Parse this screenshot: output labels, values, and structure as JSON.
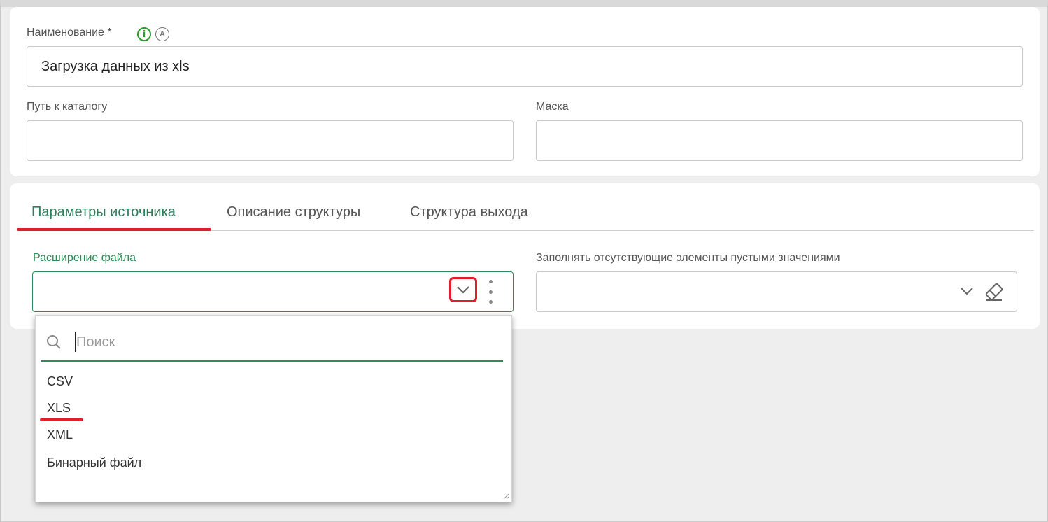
{
  "form": {
    "name_label": "Наименование *",
    "name_value": "Загрузка данных из xls",
    "path_label": "Путь к каталогу",
    "path_value": "",
    "mask_label": "Маска",
    "mask_value": ""
  },
  "icons": {
    "info": "info-icon",
    "auto": "auto-a-icon",
    "chevron": "chevron-down-icon",
    "kebab": "more-vertical-icon",
    "eraser": "eraser-icon",
    "search": "search-icon"
  },
  "tabs": [
    {
      "label": "Параметры источника",
      "active": true
    },
    {
      "label": "Описание структуры",
      "active": false
    },
    {
      "label": "Структура выхода",
      "active": false
    }
  ],
  "source_params": {
    "extension_label": "Расширение файла",
    "extension_value": "",
    "fill_missing_label": "Заполнять отсутствующие элементы пустыми значениями",
    "fill_missing_value": ""
  },
  "dropdown": {
    "search_placeholder": "Поиск",
    "options": [
      "CSV",
      "XLS",
      "XML",
      "Бинарный файл"
    ]
  },
  "colors": {
    "accent_green": "#2e8b57",
    "highlight_red": "#e31e2c"
  }
}
